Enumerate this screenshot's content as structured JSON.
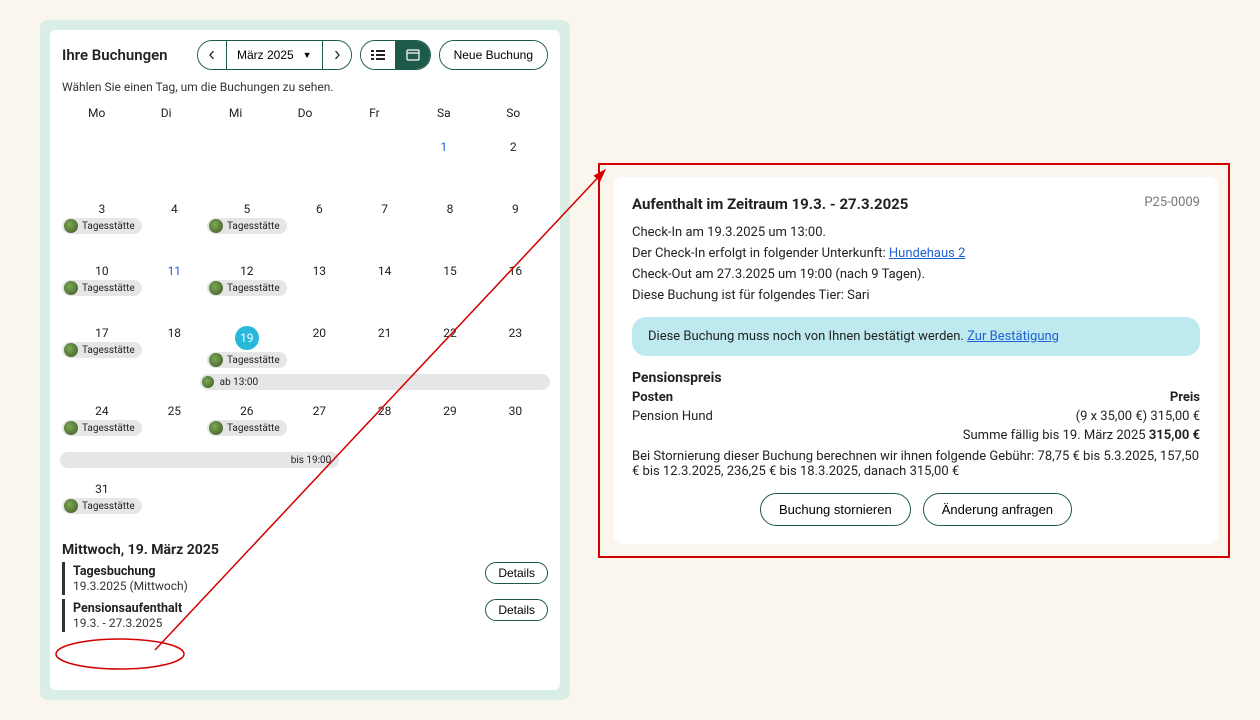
{
  "left": {
    "title": "Ihre Buchungen",
    "month_label": "März 2025",
    "new_booking": "Neue Buchung",
    "help": "Wählen Sie einen Tag, um die Buchungen zu sehen.",
    "weekdays": [
      "Mo",
      "Di",
      "Mi",
      "Do",
      "Fr",
      "Sa",
      "So"
    ],
    "tag_label": "Tagesstätte",
    "bar_from": "ab 13:00",
    "bar_until": "bis 19:00",
    "selected_date": "Mittwoch, 19. März 2025",
    "items": [
      {
        "title": "Tagesbuchung",
        "sub": "19.3.2025 (Mittwoch)",
        "btn": "Details"
      },
      {
        "title": "Pensionsaufenthalt",
        "sub": "19.3. - 27.3.2025",
        "btn": "Details"
      }
    ]
  },
  "right": {
    "title": "Aufenthalt im Zeitraum 19.3. - 27.3.2025",
    "id": "P25-0009",
    "line1": "Check-In am 19.3.2025 um 13:00.",
    "line2_pre": "Der Check-In erfolgt in folgender Unterkunft: ",
    "line2_link": "Hundehaus 2",
    "line3": "Check-Out am 27.3.2025 um 19:00 (nach 9 Tagen).",
    "line4": "Diese Buchung ist für folgendes Tier: Sari",
    "alert_text": "Diese Buchung muss noch von Ihnen bestätigt werden. ",
    "alert_link": "Zur Bestätigung",
    "price_title": "Pensionspreis",
    "th_item": "Posten",
    "th_price": "Preis",
    "row_item": "Pension Hund",
    "row_price": "(9 x 35,00 €) 315,00 €",
    "sum_label": "Summe fällig bis 19. März 2025 ",
    "sum_value": "315,00 €",
    "cancel_note": "Bei Stornierung dieser Buchung berechnen wir ihnen folgende Gebühr: 78,75 € bis 5.3.2025, 157,50 € bis 12.3.2025, 236,25 € bis 18.3.2025, danach 315,00 €",
    "btn_cancel": "Buchung stornieren",
    "btn_change": "Änderung anfragen"
  }
}
